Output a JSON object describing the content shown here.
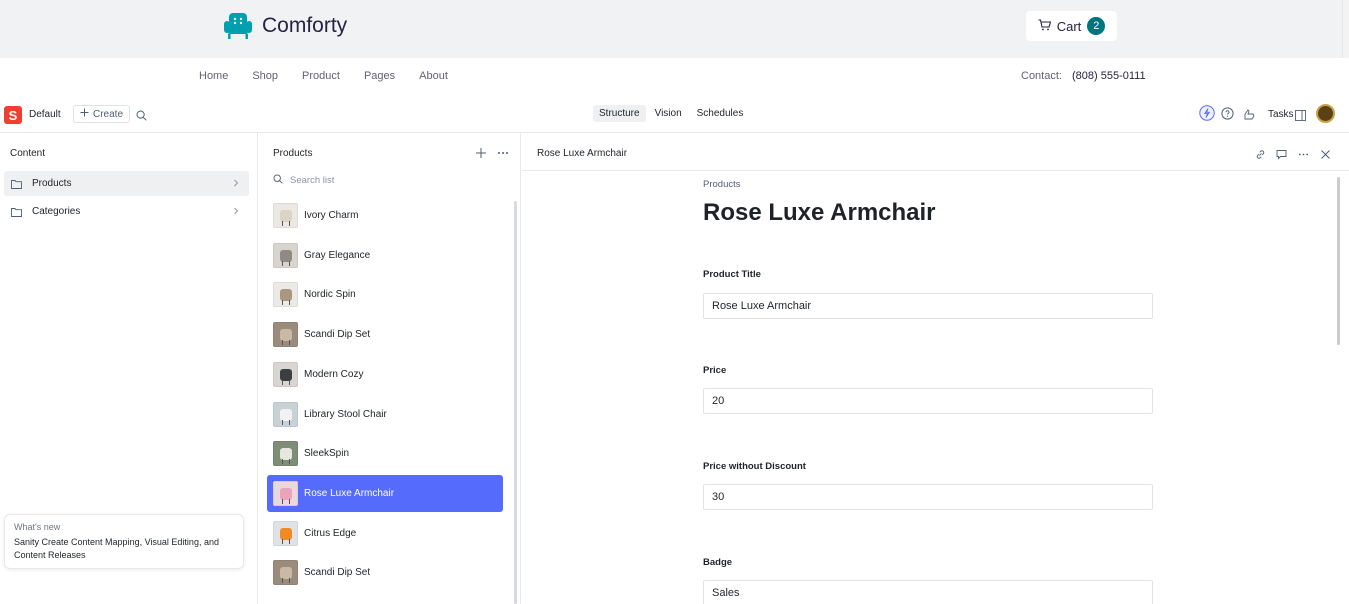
{
  "storefront": {
    "brand": "Comforty",
    "cart_label": "Cart",
    "cart_count": "2",
    "nav": [
      "Home",
      "Shop",
      "Product",
      "Pages",
      "About"
    ],
    "contact_label": "Contact:",
    "contact_phone": "(808) 555-0111"
  },
  "studio": {
    "workspace_logo": "S",
    "workspace": "Default",
    "create_label": "Create",
    "tools": [
      "Structure",
      "Vision",
      "Schedules"
    ],
    "active_tool": "Structure",
    "tasks_label": "Tasks"
  },
  "content_pane": {
    "title": "Content",
    "items": [
      {
        "label": "Products",
        "icon": "folder-icon",
        "active": true
      },
      {
        "label": "Categories",
        "icon": "folder-icon",
        "active": false
      }
    ]
  },
  "whats_new": {
    "title": "What's new",
    "body": "Sanity Create Content Mapping, Visual Editing, and Content Releases"
  },
  "products_pane": {
    "title": "Products",
    "search_placeholder": "Search list",
    "items": [
      {
        "name": "Ivory Charm",
        "bg": "#ece9e4",
        "seat": "#d9d3c8"
      },
      {
        "name": "Gray Elegance",
        "bg": "#d8d4ce",
        "seat": "#8f8a84"
      },
      {
        "name": "Nordic Spin",
        "bg": "#eceae6",
        "seat": "#a9977f"
      },
      {
        "name": "Scandi Dip Set",
        "bg": "#9a8b7c",
        "seat": "#c9b9a5"
      },
      {
        "name": "Modern Cozy",
        "bg": "#d9d6d1",
        "seat": "#3b3f41"
      },
      {
        "name": "Library Stool Chair",
        "bg": "#c8d2d6",
        "seat": "#f2f2f2"
      },
      {
        "name": "SleekSpin",
        "bg": "#7f8c76",
        "seat": "#e5e6df"
      },
      {
        "name": "Rose Luxe Armchair",
        "bg": "#e9d8df",
        "seat": "#e9a3bb",
        "selected": true
      },
      {
        "name": "Citrus Edge",
        "bg": "#dfe3e6",
        "seat": "#f08a24"
      },
      {
        "name": "Scandi Dip Set",
        "bg": "#9a8b7c",
        "seat": "#c9b9a5"
      }
    ]
  },
  "document": {
    "header_title": "Rose Luxe Armchair",
    "breadcrumb": "Products",
    "title": "Rose Luxe Armchair",
    "fields": [
      {
        "label": "Product Title",
        "value": "Rose Luxe Armchair"
      },
      {
        "label": "Price",
        "value": "20"
      },
      {
        "label": "Price without Discount",
        "value": "30"
      },
      {
        "label": "Badge",
        "value": "Sales"
      }
    ]
  },
  "colors": {
    "accent": "#556bfc",
    "brand_teal": "#007580",
    "sanity_red": "#f03e2f"
  }
}
